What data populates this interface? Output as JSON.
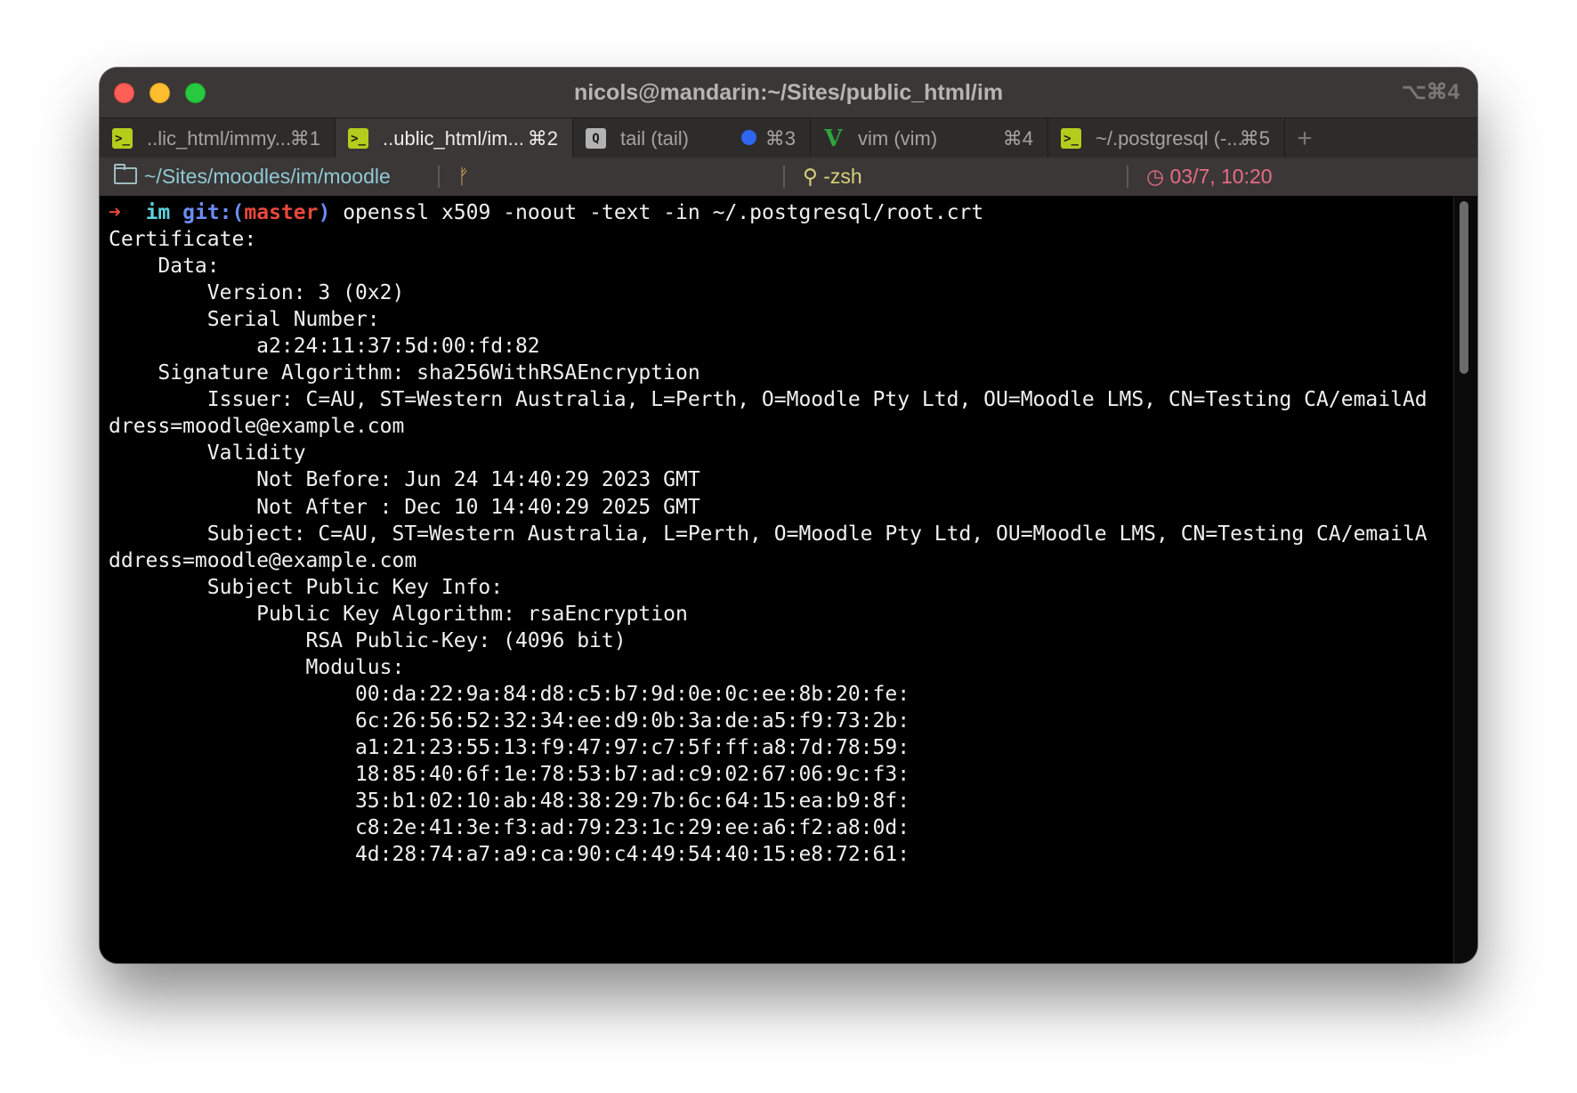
{
  "window": {
    "title": "nicols@mandarin:~/Sites/public_html/im",
    "shortcut": "⌥⌘4"
  },
  "tabs": [
    {
      "icon": "terminal-icon",
      "label": "..lic_html/immy...",
      "key": "⌘1",
      "active": false
    },
    {
      "icon": "terminal-icon",
      "label": "..ublic_html/im...",
      "key": "⌘2",
      "active": true
    },
    {
      "icon": "search-icon",
      "label": "tail (tail)",
      "key": "⌘3",
      "active": false,
      "badge": "blue-dot"
    },
    {
      "icon": "vim-icon",
      "label": "vim (vim)",
      "key": "⌘4",
      "active": false
    },
    {
      "icon": "terminal-icon",
      "label": "~/.postgresql (-...",
      "key": "⌘5",
      "active": false
    }
  ],
  "new_tab_label": "+",
  "status": {
    "path": "~/Sites/moodles/im/moodle",
    "shell": "-zsh",
    "datetime": "03/7, 10:20"
  },
  "prompt": {
    "arrow": "➜",
    "dir": "im",
    "git_prefix": "git:(",
    "branch": "master",
    "git_suffix": ")",
    "command": "openssl x509 -noout -text -in ~/.postgresql/root.crt"
  },
  "output": [
    "Certificate:",
    "    Data:",
    "        Version: 3 (0x2)",
    "        Serial Number:",
    "            a2:24:11:37:5d:00:fd:82",
    "    Signature Algorithm: sha256WithRSAEncryption",
    "        Issuer: C=AU, ST=Western Australia, L=Perth, O=Moodle Pty Ltd, OU=Moodle LMS, CN=Testing CA/emailAd",
    "dress=moodle@example.com",
    "        Validity",
    "            Not Before: Jun 24 14:40:29 2023 GMT",
    "            Not After : Dec 10 14:40:29 2025 GMT",
    "        Subject: C=AU, ST=Western Australia, L=Perth, O=Moodle Pty Ltd, OU=Moodle LMS, CN=Testing CA/emailA",
    "ddress=moodle@example.com",
    "        Subject Public Key Info:",
    "            Public Key Algorithm: rsaEncryption",
    "                RSA Public-Key: (4096 bit)",
    "                Modulus:",
    "                    00:da:22:9a:84:d8:c5:b7:9d:0e:0c:ee:8b:20:fe:",
    "                    6c:26:56:52:32:34:ee:d9:0b:3a:de:a5:f9:73:2b:",
    "                    a1:21:23:55:13:f9:47:97:c7:5f:ff:a8:7d:78:59:",
    "                    18:85:40:6f:1e:78:53:b7:ad:c9:02:67:06:9c:f3:",
    "                    35:b1:02:10:ab:48:38:29:7b:6c:64:15:ea:b9:8f:",
    "                    c8:2e:41:3e:f3:ad:79:23:1c:29:ee:a6:f2:a8:0d:",
    "                    4d:28:74:a7:a9:ca:90:c4:49:54:40:15:e8:72:61:"
  ]
}
